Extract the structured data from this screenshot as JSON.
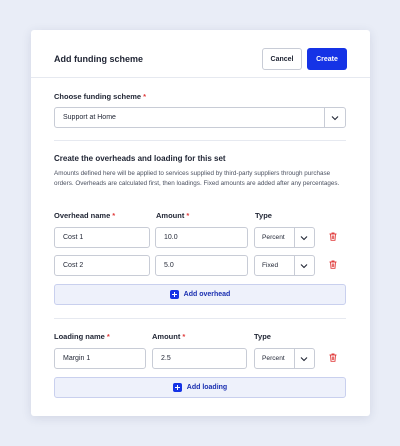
{
  "header": {
    "title": "Add funding scheme",
    "cancel_label": "Cancel",
    "create_label": "Create"
  },
  "scheme": {
    "label": "Choose funding scheme",
    "required_mark": "*",
    "selected": "Support at Home"
  },
  "overheads_section": {
    "title": "Create the overheads and loading for this set",
    "description": "Amounts defined here will be applied to services supplied by third-party suppliers through purchase orders. Overheads are calculated first, then loadings. Fixed amounts are added after any percentages."
  },
  "overheads": {
    "columns": {
      "name": "Overhead name",
      "amount": "Amount",
      "type": "Type"
    },
    "required_mark": "*",
    "rows": [
      {
        "name": "Cost 1",
        "amount": "10.0",
        "type": "Percent"
      },
      {
        "name": "Cost 2",
        "amount": "5.0",
        "type": "Fixed"
      }
    ],
    "add_label": "Add overhead"
  },
  "loadings": {
    "columns": {
      "name": "Loading name",
      "amount": "Amount",
      "type": "Type"
    },
    "required_mark": "*",
    "rows": [
      {
        "name": "Margin 1",
        "amount": "2.5",
        "type": "Percent"
      }
    ],
    "add_label": "Add loading"
  },
  "colors": {
    "primary": "#1533e6",
    "danger": "#e03c3c",
    "background": "#e9edf7"
  },
  "icons": {
    "chevron": "chevron-down-icon",
    "delete": "trash-icon",
    "add": "plus-icon"
  }
}
